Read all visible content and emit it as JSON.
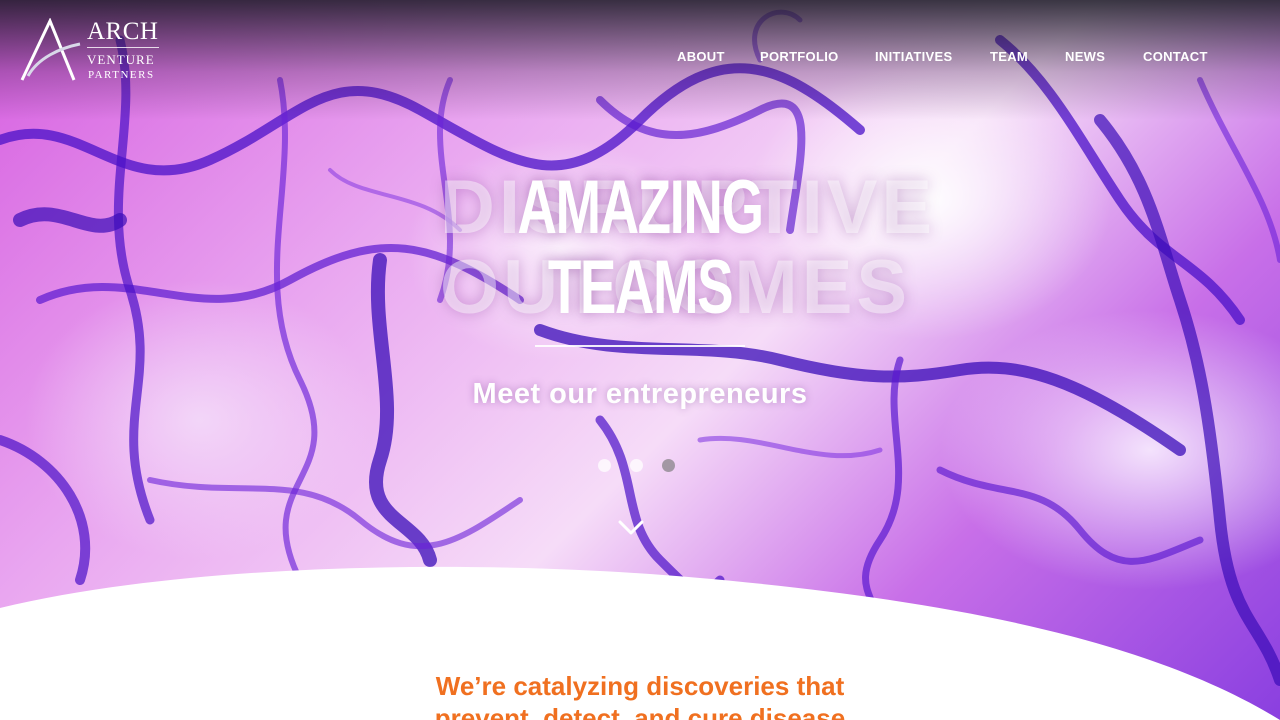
{
  "brand": {
    "name": "ARCH",
    "line2": "VENTURE",
    "line3": "PARTNERS"
  },
  "nav": {
    "items": [
      {
        "label": "ABOUT"
      },
      {
        "label": "PORTFOLIO"
      },
      {
        "label": "INITIATIVES"
      },
      {
        "label": "TEAM"
      },
      {
        "label": "NEWS"
      },
      {
        "label": "CONTACT"
      }
    ]
  },
  "hero": {
    "headline_line1": "AMAZING",
    "headline_line2": "TEAMS",
    "ghost_line1": "DISRUPTIVE",
    "ghost_line2": "OUTCOMES",
    "subline": "Meet our entrepreneurs",
    "slides_total": 3,
    "active_slide": 3
  },
  "intro": {
    "line1": "We’re catalyzing discoveries that",
    "line2": "prevent, detect, and cure disease"
  },
  "colors": {
    "accent": "#f07020",
    "vein_dark": "#4a10c8",
    "vein_mid": "#7a2ee0"
  },
  "icons": {
    "logo": "arch-logo-icon",
    "scroll": "chevron-down-icon"
  }
}
